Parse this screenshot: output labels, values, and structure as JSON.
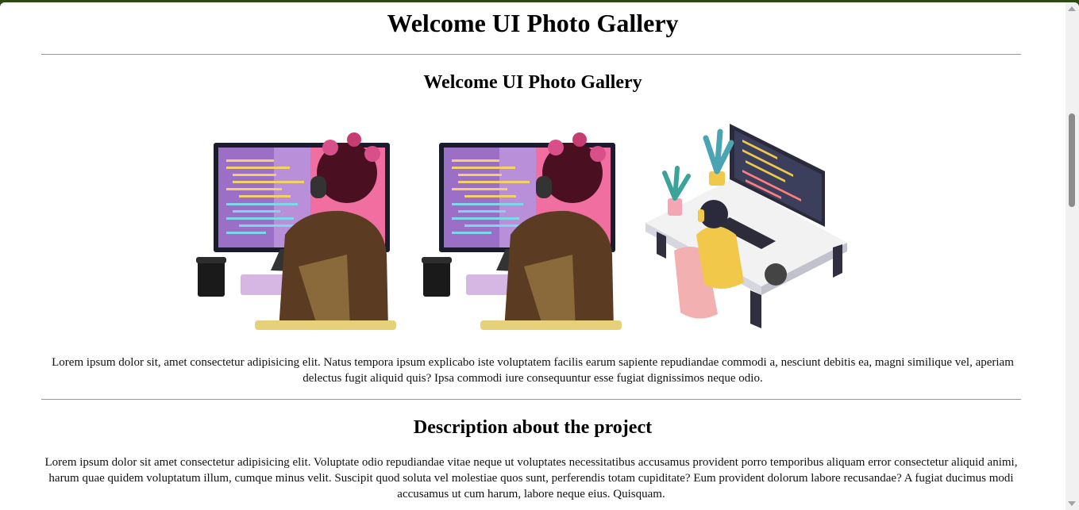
{
  "header": {
    "title": "Welcome UI Photo Gallery"
  },
  "gallery": {
    "title": "Welcome UI Photo Gallery",
    "photos": [
      {
        "name": "developer-photo-1"
      },
      {
        "name": "developer-photo-2"
      },
      {
        "name": "developer-photo-3"
      }
    ],
    "caption": "Lorem ipsum dolor sit, amet consectetur adipisicing elit. Natus tempora ipsum explicabo iste voluptatem facilis earum sapiente repudiandae commodi a, nesciunt debitis ea, magni similique vel, aperiam delectus fugit aliquid quis? Ipsa commodi iure consequuntur esse fugiat dignissimos neque odio."
  },
  "description": {
    "title": "Description about the project",
    "text": "Lorem ipsum dolor sit amet consectetur adipisicing elit. Voluptate odio repudiandae vitae neque ut voluptates necessitatibus accusamus provident porro temporibus aliquam error consectetur aliquid animi, harum quae quidem voluptatum illum, cumque minus velit. Suscipit quod soluta vel molestiae quos sunt, perferendis totam cupiditate? Eum provident dolorum labore recusandae? A fugiat ducimus modi accusamus ut cum harum, labore neque eius. Quisquam."
  },
  "colors": {
    "window_frame": "#2e4a12",
    "page_bg": "#ffffff",
    "divider": "#999999",
    "scroll_thumb": "#8c8c8c"
  }
}
